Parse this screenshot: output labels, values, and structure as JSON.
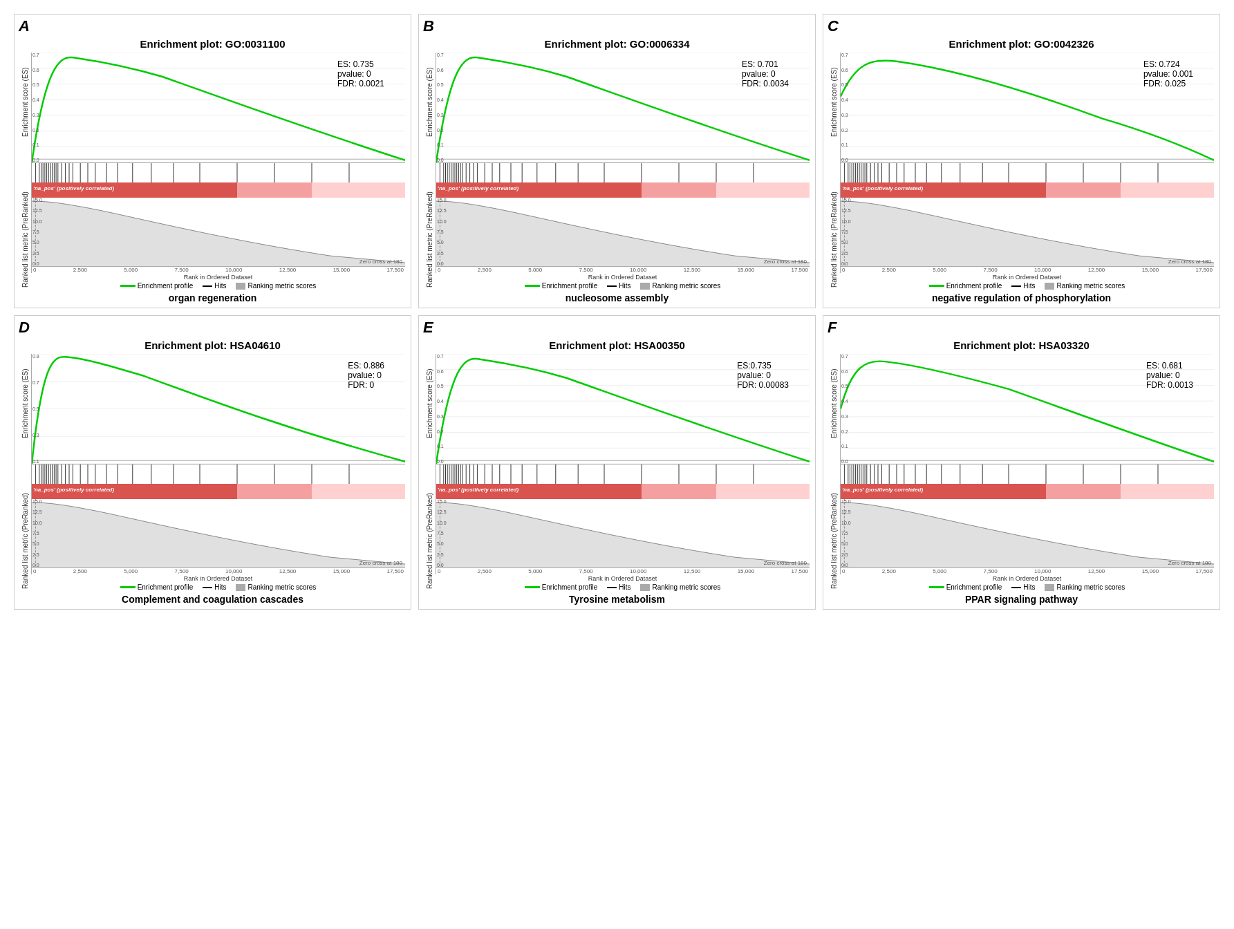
{
  "panels": [
    {
      "letter": "A",
      "title": "Enrichment plot: GO:0031100",
      "es": "ES: 0.735",
      "pvalue": "pvalue: 0",
      "fdr": "FDR: 0.0021",
      "caption": "organ regeneration",
      "caption_bold": true,
      "y_max": "0.7",
      "curve_type": "fast_rise"
    },
    {
      "letter": "B",
      "title": "Enrichment plot: GO:0006334",
      "es": "ES: 0.701",
      "pvalue": "pvalue: 0",
      "fdr": "FDR: 0.0034",
      "caption": "nucleosome assembly",
      "caption_bold": true,
      "y_max": "0.7",
      "curve_type": "fast_rise"
    },
    {
      "letter": "C",
      "title": "Enrichment plot: GO:0042326",
      "es": "ES: 0.724",
      "pvalue": "pvalue: 0.001",
      "fdr": "FDR: 0.025",
      "caption": "negative regulation of phosphorylation",
      "caption_bold": true,
      "y_max": "0.7",
      "curve_type": "slow_rise"
    },
    {
      "letter": "D",
      "title": "Enrichment plot: HSA04610",
      "es": "ES: 0.886",
      "pvalue": "pvalue: 0",
      "fdr": "FDR: 0",
      "caption": "Complement and coagulation cascades",
      "caption_bold": true,
      "y_max": "0.9",
      "curve_type": "fast_rise_high"
    },
    {
      "letter": "E",
      "title": "Enrichment plot: HSA00350",
      "es": "ES:0.735",
      "pvalue": "pvalue: 0",
      "fdr": "FDR: 0.00083",
      "caption": "Tyrosine metabolism",
      "caption_bold": true,
      "y_max": "0.7",
      "curve_type": "fast_rise"
    },
    {
      "letter": "F",
      "title": "Enrichment plot: HSA03320",
      "es": "ES: 0.681",
      "pvalue": "pvalue: 0",
      "fdr": "FDR: 0.0013",
      "caption": "PPAR signaling pathway",
      "caption_bold": true,
      "y_max": "0.7",
      "curve_type": "medium_rise"
    }
  ],
  "x_axis_label": "Rank in Ordered Dataset",
  "y_axis_label_top": "Enrichment score (ES)",
  "y_axis_label_bottom": "Ranked list metric (PreRanked)",
  "legend": {
    "enrichment_profile": "Enrichment profile",
    "hits": "Hits",
    "ranking_metric_scores": "Ranking metric scores"
  },
  "zero_cross_label": "Zero cross at 180",
  "na_pos_label": "'na_pos' (positively correlated)"
}
